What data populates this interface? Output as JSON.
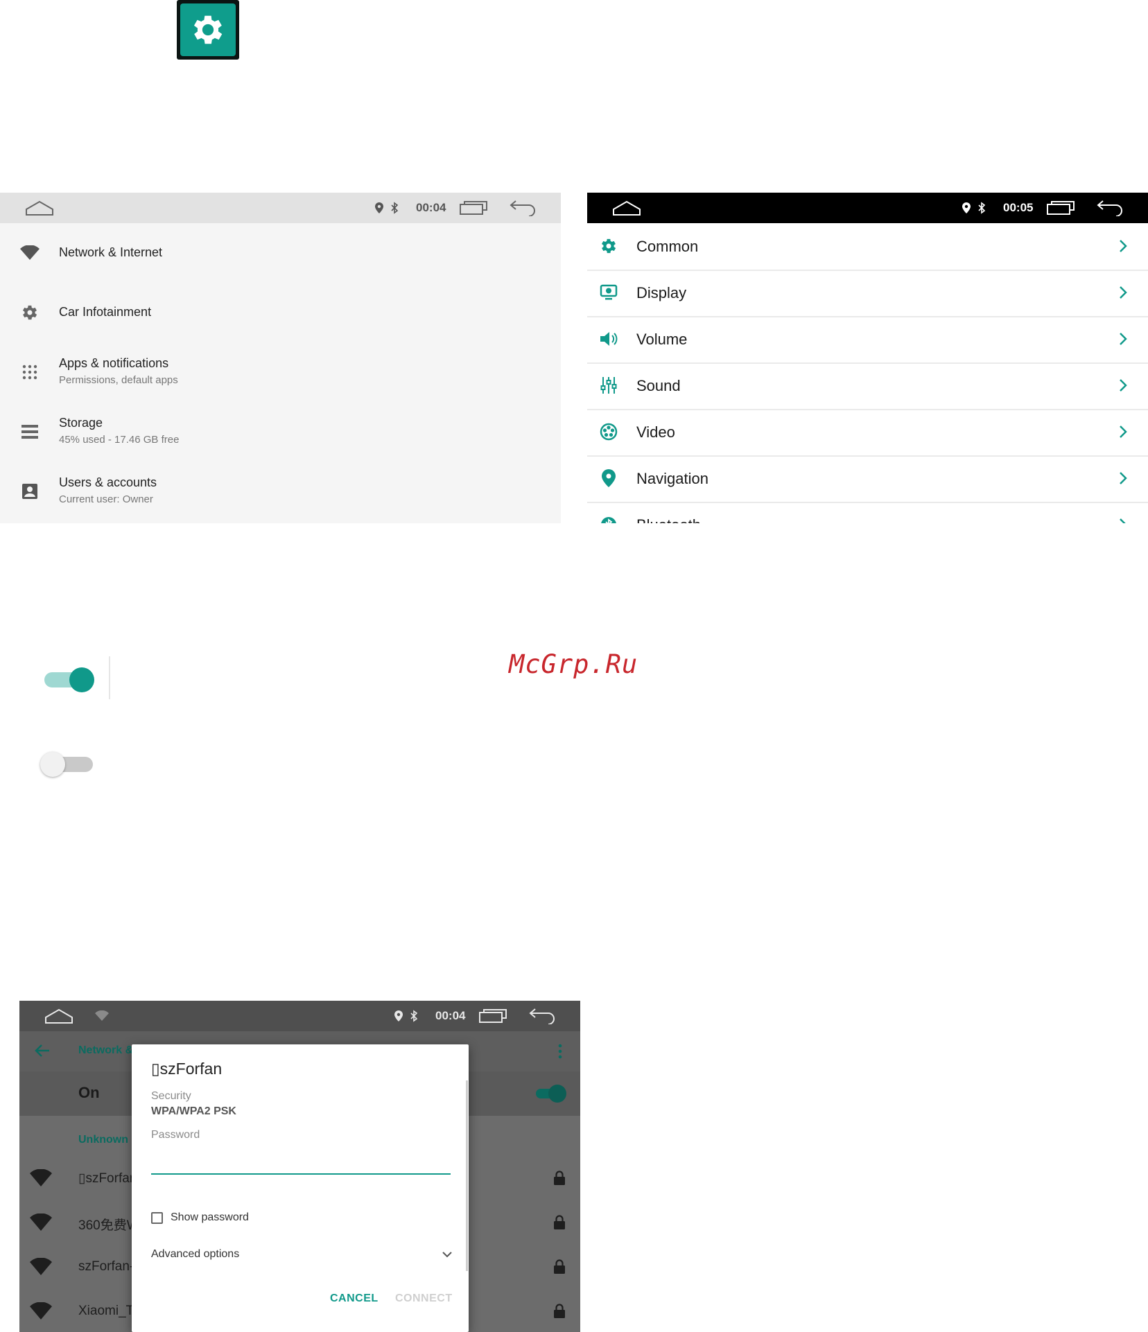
{
  "app_icon": {
    "name": "gear-icon",
    "accent": "#0f9d8c"
  },
  "panel1": {
    "statusbar": {
      "time": "00:04"
    },
    "items": [
      {
        "title": "Network & Internet",
        "subtitle": "",
        "icon": "wifi-icon"
      },
      {
        "title": "Car Infotainment",
        "subtitle": "",
        "icon": "gear-icon"
      },
      {
        "title": "Apps & notifications",
        "subtitle": "Permissions, default apps",
        "icon": "apps-grid-icon"
      },
      {
        "title": "Storage",
        "subtitle": "45% used - 17.46 GB free",
        "icon": "storage-icon"
      },
      {
        "title": "Users & accounts",
        "subtitle": "Current user: Owner",
        "icon": "account-icon"
      }
    ]
  },
  "panel2": {
    "statusbar": {
      "time": "00:05"
    },
    "accent": "#10998a",
    "items": [
      {
        "label": "Common",
        "icon": "gear-icon"
      },
      {
        "label": "Display",
        "icon": "display-icon"
      },
      {
        "label": "Volume",
        "icon": "speaker-icon"
      },
      {
        "label": "Sound",
        "icon": "equalizer-icon"
      },
      {
        "label": "Video",
        "icon": "film-reel-icon"
      },
      {
        "label": "Navigation",
        "icon": "location-pin-icon"
      },
      {
        "label": "Bluetooth",
        "icon": "bluetooth-icon"
      }
    ]
  },
  "watermark": "McGrp.Ru",
  "toggles": {
    "on": {
      "state": "on",
      "color": "#10998a"
    },
    "off": {
      "state": "off"
    }
  },
  "panel3": {
    "statusbar": {
      "time": "00:04"
    },
    "appbar_title": "Network &",
    "wifi_state": "On",
    "section_header": "Unknown",
    "networks": [
      {
        "ssid": "▯szForfan"
      },
      {
        "ssid": "360免费W"
      },
      {
        "ssid": "szForfan-"
      },
      {
        "ssid": "Xiaomi_T"
      }
    ],
    "dialog": {
      "title": "▯szForfan",
      "security_label": "Security",
      "security_value": "WPA/WPA2 PSK",
      "password_label": "Password",
      "password_value": "",
      "show_password_label": "Show password",
      "show_password_checked": false,
      "advanced_label": "Advanced options",
      "cancel_label": "CANCEL",
      "connect_label": "CONNECT"
    }
  }
}
